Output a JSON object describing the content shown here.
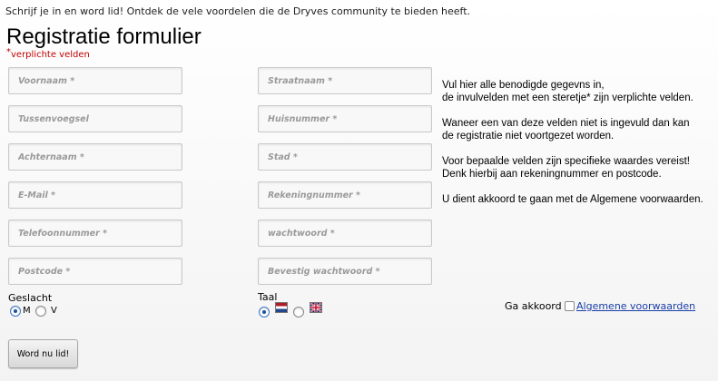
{
  "header": {
    "intro": "Schrijf je in en word lid! Ontdek de vele voordelen die de Dryves community te bieden heeft.",
    "title": "Registratie formulier",
    "required_star": "*",
    "required_note": "verplichte velden"
  },
  "fields_left": [
    {
      "placeholder": "Voornaam *"
    },
    {
      "placeholder": "Tussenvoegsel"
    },
    {
      "placeholder": "Achternaam *"
    },
    {
      "placeholder": "E-Mail *"
    },
    {
      "placeholder": "Telefoonnummer *"
    },
    {
      "placeholder": "Postcode *"
    }
  ],
  "fields_right": [
    {
      "placeholder": "Straatnaam *"
    },
    {
      "placeholder": "Huisnummer *"
    },
    {
      "placeholder": "Stad *"
    },
    {
      "placeholder": "Rekeningnummer *"
    },
    {
      "placeholder": "wachtwoord *"
    },
    {
      "placeholder": "Bevestig wachtwoord *"
    }
  ],
  "help": {
    "p1_line1": "Vul hier alle benodigde gegevns in,",
    "p1_line2": "de invulvelden met een steretje* zijn verplichte velden.",
    "p2_line1": "Waneer een van deze velden niet is ingevuld dan kan",
    "p2_line2": "de registratie niet voortgezet worden.",
    "p3_line1": "Voor bepaalde velden zijn specifieke waardes vereist!",
    "p3_line2": "Denk hierbij aan rekeningnummer en postcode.",
    "p4_line1": "U dient akkoord te gaan met de Algemene voorwaarden."
  },
  "gender": {
    "label": "Geslacht",
    "options": [
      {
        "label": "M",
        "checked": true
      },
      {
        "label": "V",
        "checked": false
      }
    ]
  },
  "language": {
    "label": "Taal",
    "options": [
      {
        "flag": "netherlands-flag",
        "checked": true
      },
      {
        "flag": "uk-flag",
        "checked": false
      }
    ]
  },
  "terms": {
    "prefix": "Ga akkoord",
    "link": "Algemene voorwaarden",
    "checked": false
  },
  "submit_label": "Word nu lid!",
  "colors": {
    "required": "#c00000",
    "link": "#1a3ea8",
    "radio_dot": "#1e4f9a"
  }
}
